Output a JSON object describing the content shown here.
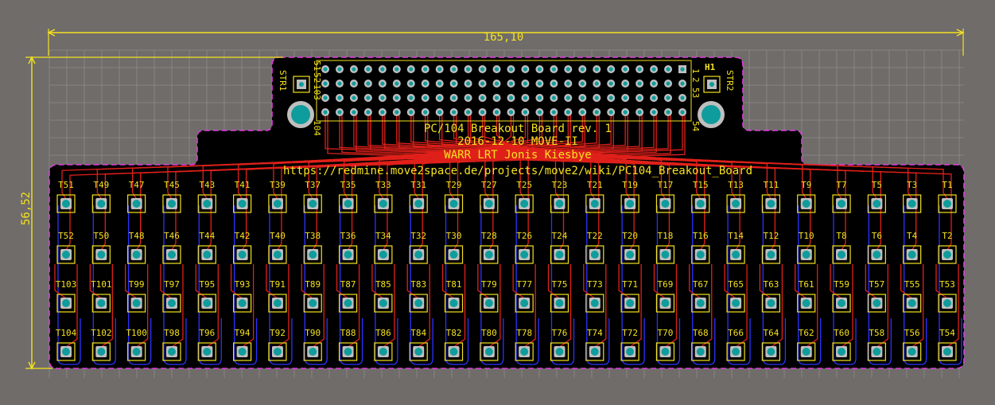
{
  "board": {
    "title_lines": [
      "PC/104 Breakout Board rev. 1",
      "2016-12-10 MOVE-II",
      "WARR LRT Jonis Kiesbye",
      "https://redmine.move2space.de/projects/move2/wiki/PC104_Breakout_Board"
    ]
  },
  "dimensions": {
    "width": "165,10",
    "height": "56,52"
  },
  "header": {
    "ref": "H1",
    "pin_labels": {
      "top_left": "51",
      "top_left2": "52",
      "top_left3": "103",
      "bottom_left": "104",
      "top_right": "1",
      "top_right2": "2",
      "top_right3": "53",
      "bottom_right": "54"
    },
    "columns": 26,
    "rows": 4
  },
  "standoffs": {
    "left": "STR1",
    "right": "STR2"
  },
  "testpoints": {
    "row1": [
      "T51",
      "T49",
      "T47",
      "T45",
      "T43",
      "T41",
      "T39",
      "T37",
      "T35",
      "T33",
      "T31",
      "T29",
      "T27",
      "T25",
      "T23",
      "T21",
      "T19",
      "T17",
      "T15",
      "T13",
      "T11",
      "T9",
      "T7",
      "T5",
      "T3",
      "T1"
    ],
    "row2": [
      "T52",
      "T50",
      "T48",
      "T46",
      "T44",
      "T42",
      "T40",
      "T38",
      "T36",
      "T34",
      "T32",
      "T30",
      "T28",
      "T26",
      "T24",
      "T22",
      "T20",
      "T18",
      "T16",
      "T14",
      "T12",
      "T10",
      "T8",
      "T6",
      "T4",
      "T2"
    ],
    "row3": [
      "T103",
      "T101",
      "T99",
      "T97",
      "T95",
      "T93",
      "T91",
      "T89",
      "T87",
      "T85",
      "T83",
      "T81",
      "T79",
      "T77",
      "T75",
      "T73",
      "T71",
      "T69",
      "T67",
      "T65",
      "T63",
      "T61",
      "T59",
      "T57",
      "T55",
      "T53"
    ],
    "row4": [
      "T104",
      "T102",
      "T100",
      "T98",
      "T96",
      "T94",
      "T92",
      "T90",
      "T88",
      "T86",
      "T84",
      "T82",
      "T80",
      "T78",
      "T76",
      "T74",
      "T72",
      "T70",
      "T68",
      "T66",
      "T64",
      "T62",
      "T60",
      "T58",
      "T56",
      "T54"
    ]
  },
  "colors": {
    "background": "#6f6c6a",
    "board": "#000000",
    "grid": "#9a9796",
    "silkscreen": "#f5e21f",
    "outline": "#e23be0",
    "top_copper": "#e0201a",
    "bottom_copper": "#2b33ff",
    "pad": "#bfbfbf",
    "drill": "#0f9c9c"
  }
}
